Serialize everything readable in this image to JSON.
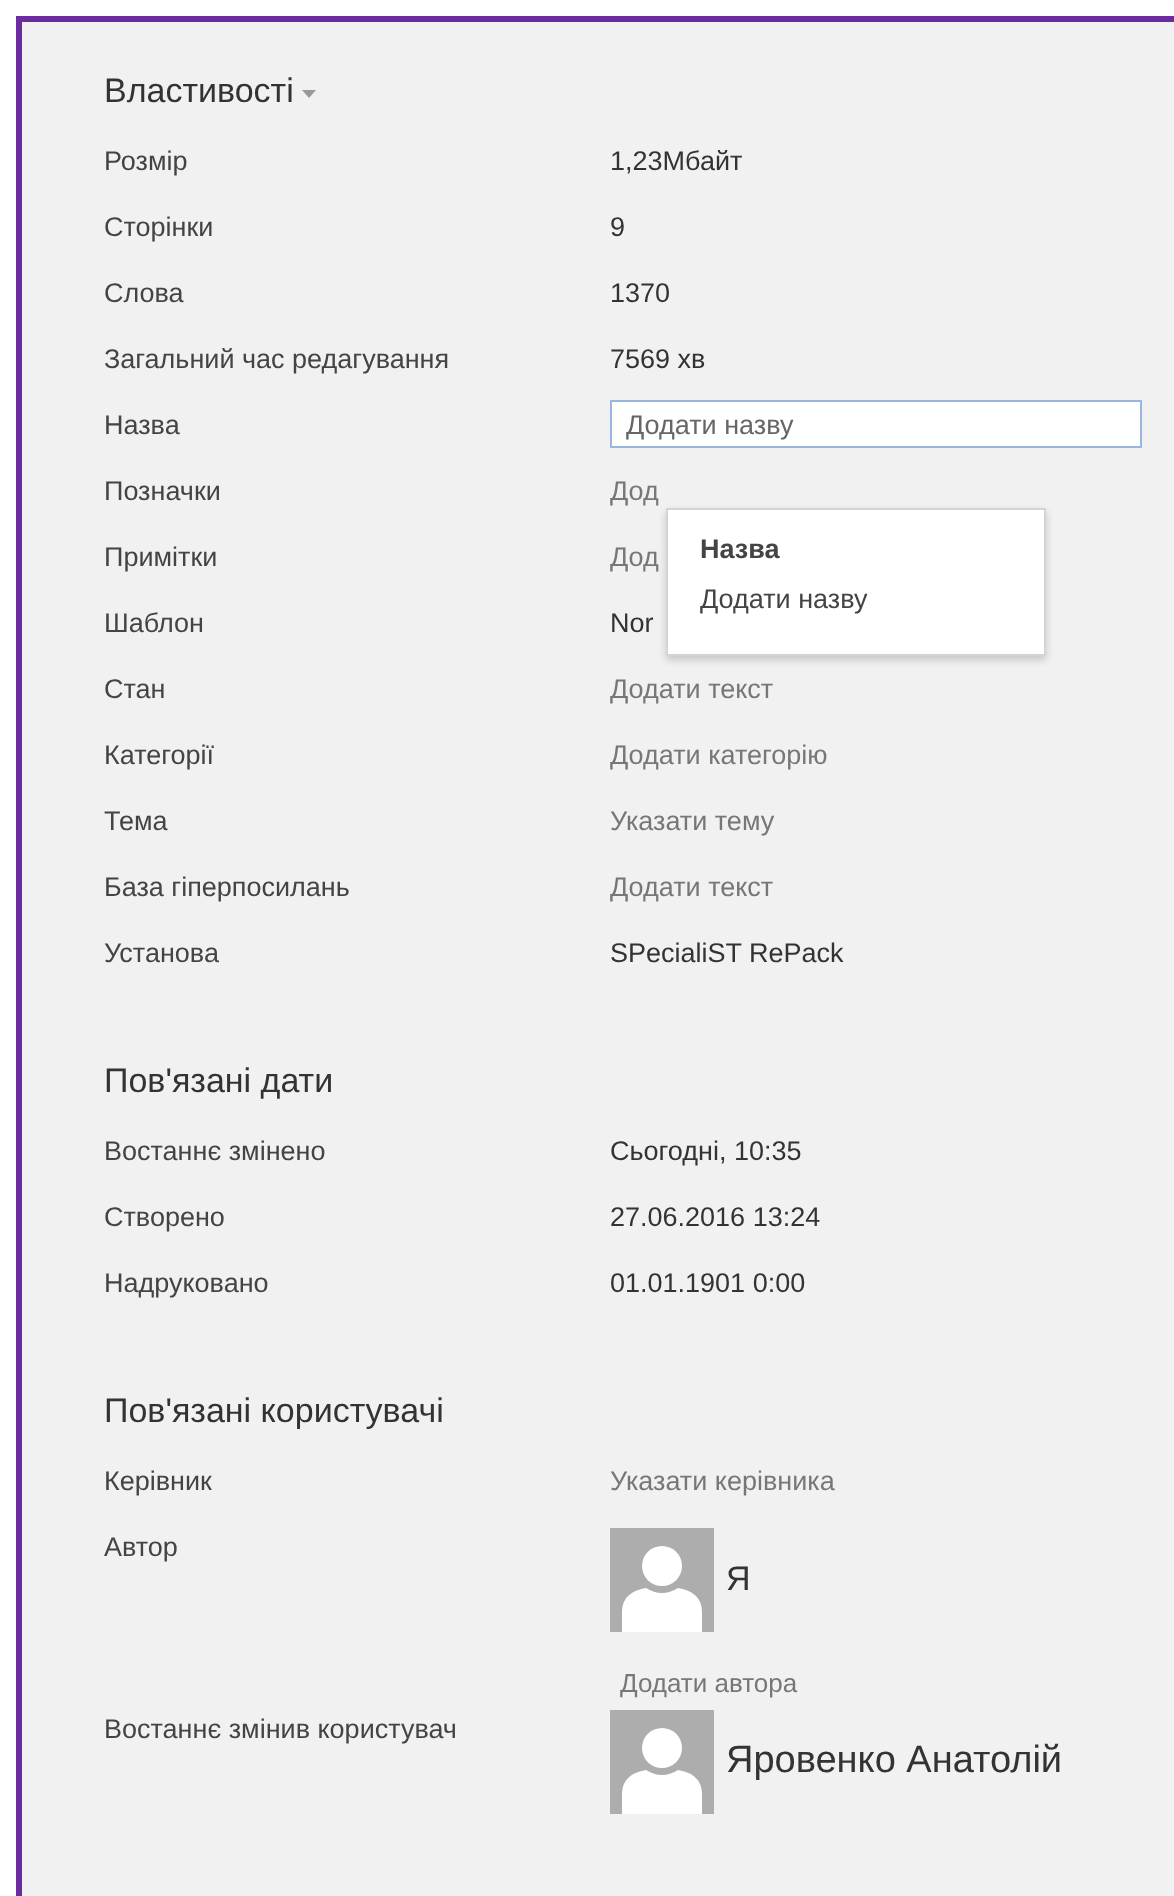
{
  "properties": {
    "title": "Властивості",
    "rows": [
      {
        "label": "Розмір",
        "kind": "value",
        "value": "1,23Мбайт"
      },
      {
        "label": "Сторінки",
        "kind": "value",
        "value": "9"
      },
      {
        "label": "Слова",
        "kind": "value",
        "value": "1370"
      },
      {
        "label": "Загальний час редагування",
        "kind": "value",
        "value": "7569 хв"
      },
      {
        "label": "Назва",
        "kind": "field",
        "placeholder": "Додати назву",
        "focused": true
      },
      {
        "label": "Позначки",
        "kind": "hint",
        "value": "Дод"
      },
      {
        "label": "Примітки",
        "kind": "hint",
        "value": "Дод"
      },
      {
        "label": "Шаблон",
        "kind": "value",
        "value": "Nor"
      },
      {
        "label": "Стан",
        "kind": "hint",
        "value": "Додати текст"
      },
      {
        "label": "Категорії",
        "kind": "hint",
        "value": "Додати категорію"
      },
      {
        "label": "Тема",
        "kind": "hint",
        "value": "Указати тему"
      },
      {
        "label": "База гіперпосилань",
        "kind": "hint",
        "value": "Додати текст"
      },
      {
        "label": "Установа",
        "kind": "value",
        "value": "SPecialiST RePack"
      }
    ],
    "tooltip": {
      "title": "Назва",
      "text": "Додати назву"
    }
  },
  "dates": {
    "title": "Пов'язані дати",
    "rows": [
      {
        "label": "Востаннє змінено",
        "kind": "value",
        "value": "Сьогодні, 10:35"
      },
      {
        "label": "Створено",
        "kind": "value",
        "value": "27.06.2016 13:24"
      },
      {
        "label": "Надруковано",
        "kind": "value",
        "value": "01.01.1901 0:00"
      }
    ]
  },
  "people": {
    "title": "Пов'язані користувачі",
    "rows": [
      {
        "label": "Керівник",
        "kind": "hint",
        "value": "Указати керівника"
      },
      {
        "label": "Автор",
        "kind": "people",
        "people": [
          {
            "name": "Я"
          }
        ],
        "add_link": "Додати автора"
      },
      {
        "label": "Востаннє змінив користувач",
        "kind": "people",
        "people": [
          {
            "name": "Яровенко Анатолій"
          }
        ]
      }
    ]
  }
}
